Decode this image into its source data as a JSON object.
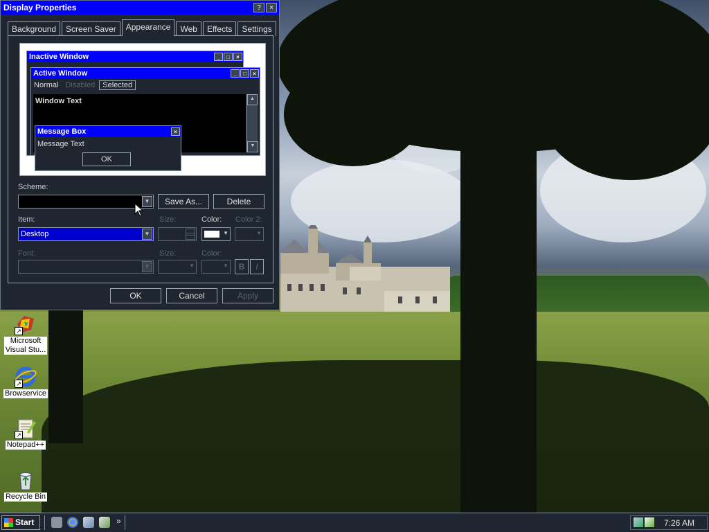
{
  "dialog": {
    "title": "Display Properties",
    "help_btn": "?",
    "close_btn": "×",
    "tabs": [
      "Background",
      "Screen Saver",
      "Appearance",
      "Web",
      "Effects",
      "Settings"
    ],
    "active_tab": "Appearance",
    "preview": {
      "inactive_title": "Inactive Window",
      "active_title": "Active Window",
      "menu": [
        "Normal",
        "Disabled",
        "Selected"
      ],
      "window_text": "Window Text",
      "msgbox_title": "Message Box",
      "msgbox_text": "Message Text",
      "msgbox_ok": "OK"
    },
    "scheme_label": "Scheme:",
    "scheme_value": "",
    "save_as": "Save As...",
    "delete": "Delete",
    "item_label": "Item:",
    "item_value": "Desktop",
    "size_label": "Size:",
    "color_label": "Color:",
    "color2_label": "Color 2:",
    "font_label": "Font:",
    "font_size_label": "Size:",
    "font_color_label": "Color:",
    "bold": "B",
    "italic": "I",
    "ok": "OK",
    "cancel": "Cancel",
    "apply": "Apply"
  },
  "desktop_icons": [
    {
      "name": "Microsoft Visual Stu...",
      "line1": "Microsoft",
      "line2": "Visual Stu..."
    },
    {
      "name": "Browservice"
    },
    {
      "name": "Notepad++"
    },
    {
      "name": "Recycle Bin"
    }
  ],
  "taskbar": {
    "start": "Start",
    "chevron": "»",
    "clock": "7:26 AM"
  },
  "colors": {
    "title_blue": "#0000ff",
    "dialog_bg": "#1f2630",
    "selection": "#0000cc"
  }
}
